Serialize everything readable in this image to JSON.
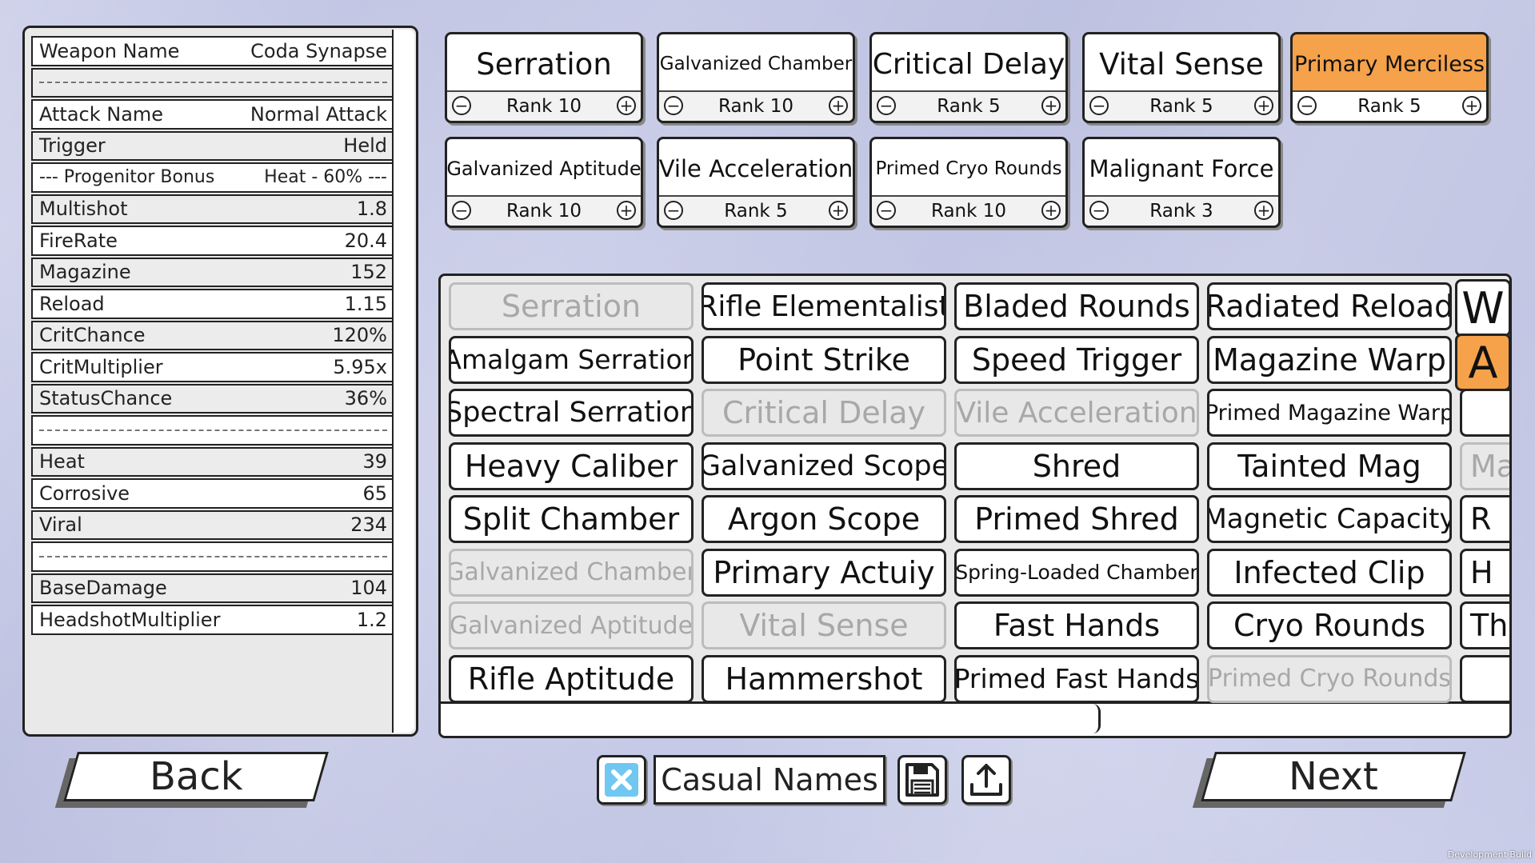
{
  "stats": [
    {
      "label": "Weapon Name",
      "value": "Coda Synapse",
      "bg": "white"
    },
    {
      "sep": true,
      "bg": "grey"
    },
    {
      "label": "Attack Name",
      "value": "Normal Attack",
      "bg": "white"
    },
    {
      "label": "Trigger",
      "value": "Held",
      "bg": "grey"
    },
    {
      "label": "--- Progenitor Bonus",
      "value": "Heat - 60%  ---",
      "bg": "white",
      "progenitor": true
    },
    {
      "label": "Multishot",
      "value": "1.8",
      "bg": "grey"
    },
    {
      "label": "FireRate",
      "value": "20.4",
      "bg": "white"
    },
    {
      "label": "Magazine",
      "value": "152",
      "bg": "grey"
    },
    {
      "label": "Reload",
      "value": "1.15",
      "bg": "white"
    },
    {
      "label": "CritChance",
      "value": "120%",
      "bg": "grey"
    },
    {
      "label": "CritMultiplier",
      "value": "5.95x",
      "bg": "white"
    },
    {
      "label": "StatusChance",
      "value": "36%",
      "bg": "grey"
    },
    {
      "sep": true,
      "bg": "white"
    },
    {
      "label": "Heat",
      "value": "39",
      "bg": "grey"
    },
    {
      "label": "Corrosive",
      "value": "65",
      "bg": "white"
    },
    {
      "label": "Viral",
      "value": "234",
      "bg": "grey"
    },
    {
      "sep": true,
      "bg": "white"
    },
    {
      "label": "BaseDamage",
      "value": "104",
      "bg": "grey"
    },
    {
      "label": "HeadshotMultiplier",
      "value": "1.2",
      "bg": "white"
    }
  ],
  "slots": [
    {
      "name": "Serration",
      "rank": "Rank 10",
      "size": 37
    },
    {
      "name": "Galvanized Chamber",
      "rank": "Rank 10",
      "size": 23
    },
    {
      "name": "Critical Delay",
      "rank": "Rank 5",
      "size": 36
    },
    {
      "name": "Vital Sense",
      "rank": "Rank 5",
      "size": 37
    },
    {
      "name": "Primary Merciless",
      "rank": "Rank 5",
      "size": 27,
      "selected": true
    },
    {
      "name": "Galvanized Aptitude",
      "rank": "Rank 10",
      "size": 24
    },
    {
      "name": "Vile Acceleration",
      "rank": "Rank 5",
      "size": 29
    },
    {
      "name": "Primed Cryo Rounds",
      "rank": "Rank 10",
      "size": 23
    },
    {
      "name": "Malignant Force",
      "rank": "Rank 3",
      "size": 29
    }
  ],
  "rank_minus": "−",
  "rank_plus": "+",
  "mods": [
    [
      {
        "name": "Serration",
        "d": true,
        "s": 38
      },
      {
        "name": "Rifle Elementalist",
        "s": 36
      },
      {
        "name": "Bladed Rounds",
        "s": 38
      },
      {
        "name": "Radiated Reload",
        "s": 38
      }
    ],
    [
      {
        "name": "Amalgam Serration",
        "s": 33
      },
      {
        "name": "Point Strike",
        "s": 38
      },
      {
        "name": "Speed Trigger",
        "s": 38
      },
      {
        "name": "Magazine Warp",
        "s": 38
      }
    ],
    [
      {
        "name": "Spectral Serration",
        "s": 35
      },
      {
        "name": "Critical Delay",
        "d": true,
        "s": 38
      },
      {
        "name": "Vile Acceleration",
        "d": true,
        "s": 36
      },
      {
        "name": "Primed Magazine Warp",
        "s": 27
      }
    ],
    [
      {
        "name": "Heavy Caliber",
        "s": 38
      },
      {
        "name": "Galvanized Scope",
        "s": 35
      },
      {
        "name": "Shred",
        "s": 38
      },
      {
        "name": "Tainted Mag",
        "s": 38
      }
    ],
    [
      {
        "name": "Split Chamber",
        "s": 38
      },
      {
        "name": "Argon Scope",
        "s": 38
      },
      {
        "name": "Primed Shred",
        "s": 38
      },
      {
        "name": "Magnetic Capacity",
        "s": 34
      }
    ],
    [
      {
        "name": "Galvanized Chamber",
        "d": true,
        "s": 30
      },
      {
        "name": "Primary Actuiy",
        "s": 38
      },
      {
        "name": "Spring-Loaded Chamber",
        "s": 25
      },
      {
        "name": "Infected Clip",
        "s": 38
      }
    ],
    [
      {
        "name": "Galvanized Aptitude",
        "d": true,
        "s": 30
      },
      {
        "name": "Vital Sense",
        "d": true,
        "s": 38
      },
      {
        "name": "Fast Hands",
        "s": 38
      },
      {
        "name": "Cryo Rounds",
        "s": 38
      }
    ],
    [
      {
        "name": "Rifle Aptitude",
        "s": 38
      },
      {
        "name": "Hammershot",
        "s": 38
      },
      {
        "name": "Primed Fast Hands",
        "s": 33
      },
      {
        "name": "Primed Cryo Rounds",
        "d": true,
        "s": 30
      }
    ]
  ],
  "partial_col": [
    "",
    "",
    "",
    "Ma",
    "R",
    "H",
    "The",
    ""
  ],
  "partial_disabled": [
    false,
    false,
    false,
    true,
    false,
    false,
    false,
    false
  ],
  "tabs": [
    {
      "letter": "W"
    },
    {
      "letter": "A",
      "active": true
    }
  ],
  "bottom": {
    "back": "Back",
    "next": "Next",
    "names_label": "Casual Names"
  },
  "dev_build": "Development Build",
  "colors": {
    "accent": "#f5a24b",
    "checkbox": "#6fc7f2",
    "background": "#c4c8e6"
  }
}
